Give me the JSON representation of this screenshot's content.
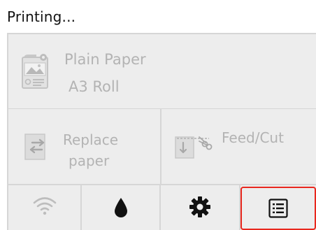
{
  "status": {
    "title": "Printing..."
  },
  "media": {
    "type_label": "Plain Paper",
    "size_label": "A3 Roll",
    "icon": "paper-roll-icon"
  },
  "actions": {
    "replace": {
      "line1": "Replace",
      "line2": "paper",
      "icon": "replace-paper-icon"
    },
    "feed_cut": {
      "label": "Feed/Cut",
      "icon": "feed-cut-icon"
    }
  },
  "nav": {
    "items": [
      {
        "icon": "wifi-icon",
        "state": "disabled"
      },
      {
        "icon": "ink-drop-icon",
        "state": "enabled"
      },
      {
        "icon": "gear-icon",
        "state": "enabled"
      },
      {
        "icon": "job-list-icon",
        "state": "highlighted"
      }
    ]
  },
  "colors": {
    "panel_bg": "#ededed",
    "disabled_text": "#b3b3b3",
    "highlight": "#e8271e",
    "active_icon": "#111111"
  }
}
